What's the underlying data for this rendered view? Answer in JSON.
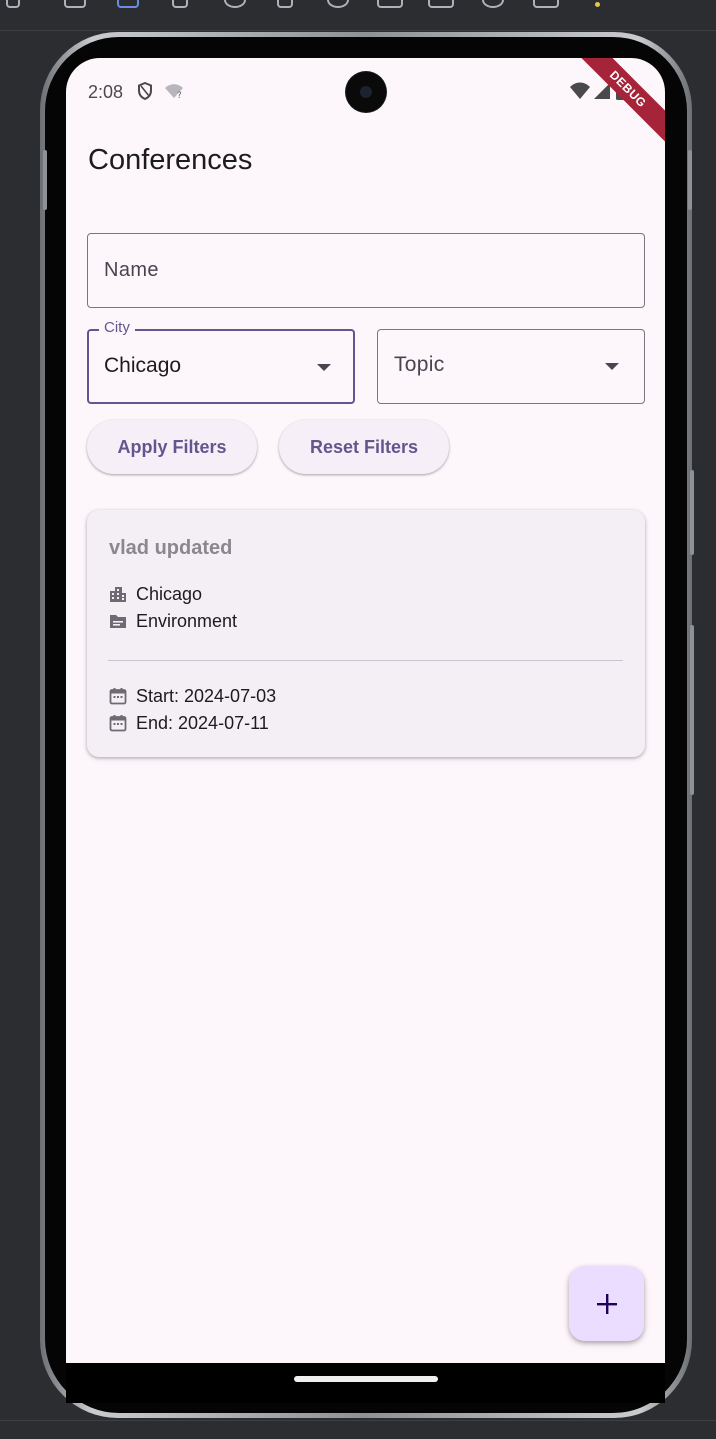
{
  "status_bar": {
    "time": "2:08"
  },
  "debug_banner": "DEBUG",
  "app_bar": {
    "title": "Conferences"
  },
  "filters": {
    "name_placeholder": "Name",
    "city_label": "City",
    "city_value": "Chicago",
    "topic_placeholder": "Topic",
    "apply_label": "Apply Filters",
    "reset_label": "Reset Filters"
  },
  "conferences": [
    {
      "name": "vlad updated",
      "city": "Chicago",
      "topic": "Environment",
      "start": "Start: 2024-07-03",
      "end": "End: 2024-07-11"
    }
  ],
  "fab": {
    "icon": "plus-icon"
  },
  "colors": {
    "primary": "#65558f",
    "background": "#fdf7fc",
    "card": "#f4eff4",
    "fab": "#eaddff",
    "debug_ribbon": "#a6243a"
  }
}
